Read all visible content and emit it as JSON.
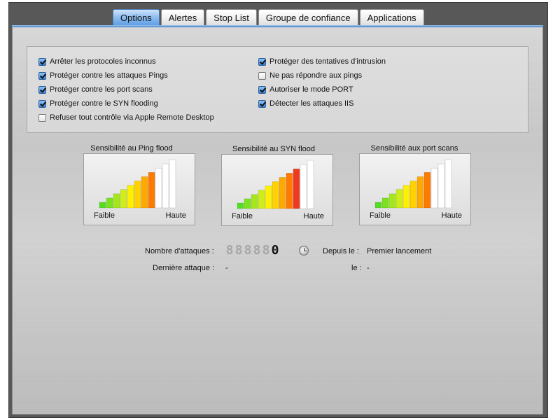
{
  "tabs": [
    {
      "label": "Options",
      "active": true
    },
    {
      "label": "Alertes",
      "active": false
    },
    {
      "label": "Stop List",
      "active": false
    },
    {
      "label": "Groupe de confiance",
      "active": false
    },
    {
      "label": "Applications",
      "active": false
    }
  ],
  "options": {
    "left": [
      {
        "label": "Arrêter les protocoles inconnus",
        "checked": true
      },
      {
        "label": "Protéger contre les attaques Pings",
        "checked": true
      },
      {
        "label": "Protéger contre les port scans",
        "checked": true
      },
      {
        "label": "Protéger contre le SYN flooding",
        "checked": true
      },
      {
        "label": "Refuser tout contrôle via Apple Remote Desktop",
        "checked": false
      }
    ],
    "right": [
      {
        "label": "Protéger des tentatives d'intrusion",
        "checked": true
      },
      {
        "label": "Ne pas répondre aux pings",
        "checked": false
      },
      {
        "label": "Autoriser le mode PORT",
        "checked": true
      },
      {
        "label": "Détecter les attaques IIS",
        "checked": true
      }
    ]
  },
  "gauges": [
    {
      "title": "Sensibilité au Ping flood",
      "low": "Faible",
      "high": "Haute",
      "level": 0.8
    },
    {
      "title": "Sensibilité au SYN flood",
      "low": "Faible",
      "high": "Haute",
      "level": 0.9
    },
    {
      "title": "Sensibilité aux port scans",
      "low": "Faible",
      "high": "Haute",
      "level": 0.8
    }
  ],
  "stats": {
    "attacks_label": "Nombre d'attaques :",
    "attacks_digits": [
      "8",
      "8",
      "8",
      "8",
      "8",
      "0"
    ],
    "since_label": "Depuis le :",
    "since_value": "Premier lancement",
    "last_attack_label": "Dernière attaque :",
    "last_attack_value": "-",
    "date_label": "le :",
    "date_value": "-"
  },
  "colors": {
    "active_tab": "#5f9fe4",
    "checkbox_checked": "#3d83d6",
    "gauge_low": "#66dd22",
    "gauge_mid": "#ffe600",
    "gauge_high": "#ee2222",
    "gauge_off": "#ffffff"
  },
  "icons": {
    "counter_reset": "clock-icon"
  }
}
